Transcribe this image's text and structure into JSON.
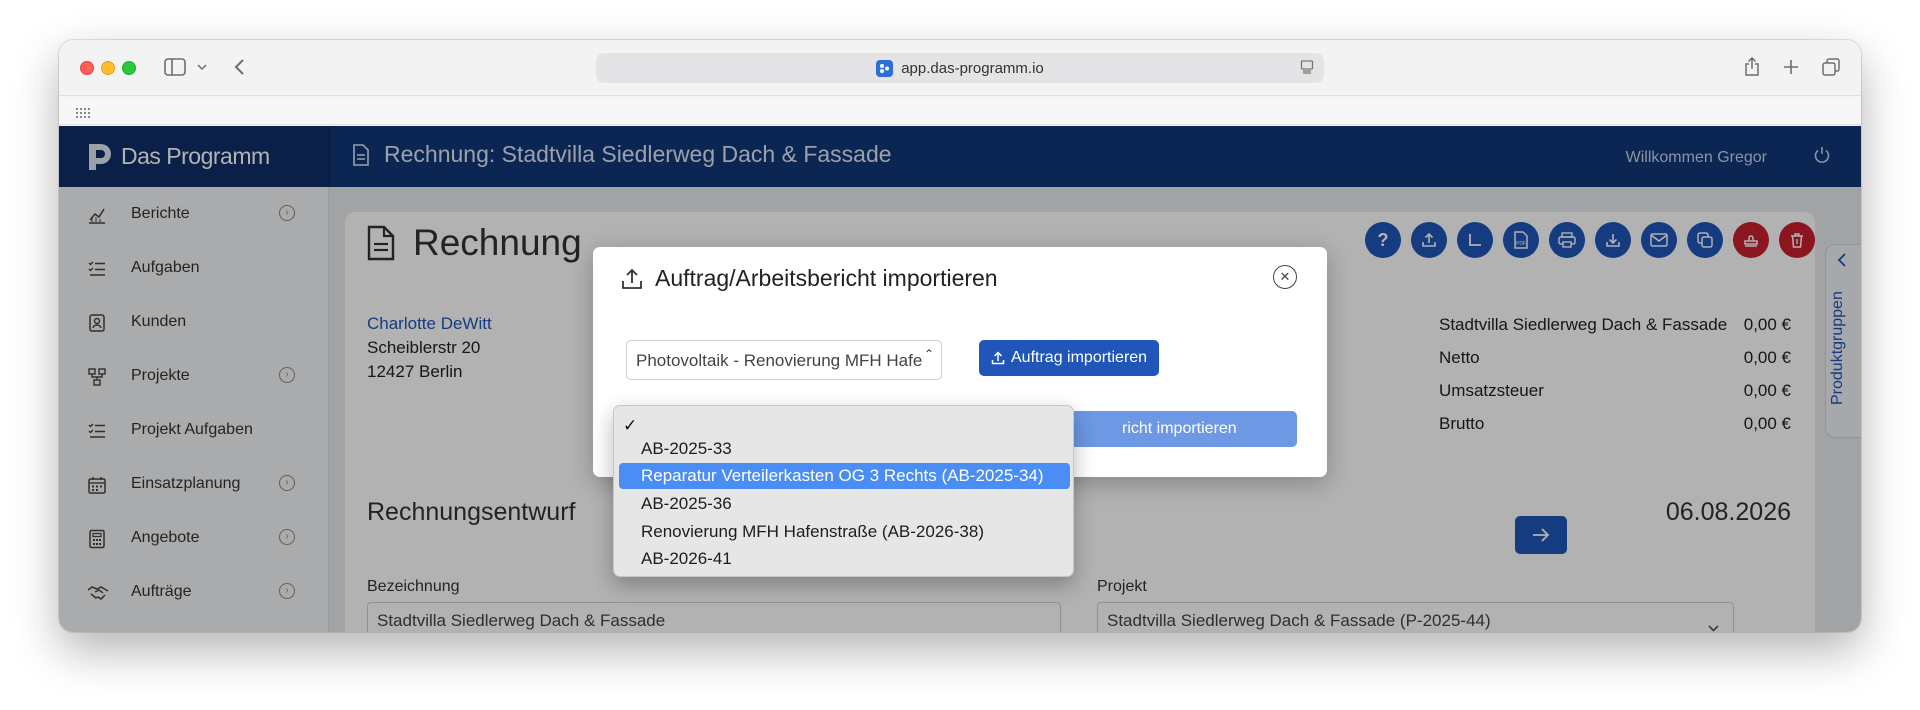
{
  "browser": {
    "url": "app.das-programm.io"
  },
  "app": {
    "logo": "Das Programm",
    "header_title": "Rechnung: Stadtvilla Siedlerweg Dach & Fassade",
    "welcome": "Willkommen Gregor"
  },
  "sidebar": {
    "items": [
      {
        "label": "Berichte",
        "icon": "chart-icon"
      },
      {
        "label": "Aufgaben",
        "icon": "task-list-icon"
      },
      {
        "label": "Kunden",
        "icon": "contact-card-icon"
      },
      {
        "label": "Projekte",
        "icon": "project-icon"
      },
      {
        "label": "Projekt Aufgaben",
        "icon": "task-list-icon"
      },
      {
        "label": "Einsatzplanung",
        "icon": "calendar-icon"
      },
      {
        "label": "Angebote",
        "icon": "calculator-icon"
      },
      {
        "label": "Aufträge",
        "icon": "handshake-icon"
      }
    ]
  },
  "page": {
    "title": "Rechnung",
    "customer": {
      "name": "Charlotte DeWitt",
      "street": "Scheiblerstr 20",
      "city": "12427 Berlin"
    },
    "totals": [
      {
        "label": "Stadtvilla Siedlerweg Dach & Fassade",
        "value": "0,00 €"
      },
      {
        "label": "Netto",
        "value": "0,00 €"
      },
      {
        "label": "Umsatzsteuer",
        "value": "0,00 €"
      },
      {
        "label": "Brutto",
        "value": "0,00 €"
      }
    ],
    "section_title": "Rechnungsentwurf",
    "date": "06.08.2026",
    "fields": {
      "bezeichnung_label": "Bezeichnung",
      "bezeichnung_value": "Stadtvilla Siedlerweg Dach & Fassade",
      "projekt_label": "Projekt",
      "projekt_value": "Stadtvilla Siedlerweg Dach & Fassade (P-2025-44)"
    },
    "side_tab": "Produktgruppen"
  },
  "modal": {
    "title": "Auftrag/Arbeitsbericht importieren",
    "auftrag_select_value": "Photovoltaik - Renovierung MFH Hafe",
    "import_auftrag_button": "Auftrag importieren",
    "import_bericht_button_visible": "richt importieren"
  },
  "dropdown": {
    "options": [
      {
        "label": "",
        "checked": true
      },
      {
        "label": "AB-2025-33",
        "checked": false
      },
      {
        "label": "Reparatur Verteilerkasten OG 3 Rechts (AB-2025-34)",
        "highlighted": true
      },
      {
        "label": "AB-2025-36",
        "checked": false
      },
      {
        "label": "Renovierung MFH Hafenstraße (AB-2026-38)",
        "checked": false
      },
      {
        "label": "AB-2026-41",
        "checked": false
      }
    ]
  }
}
